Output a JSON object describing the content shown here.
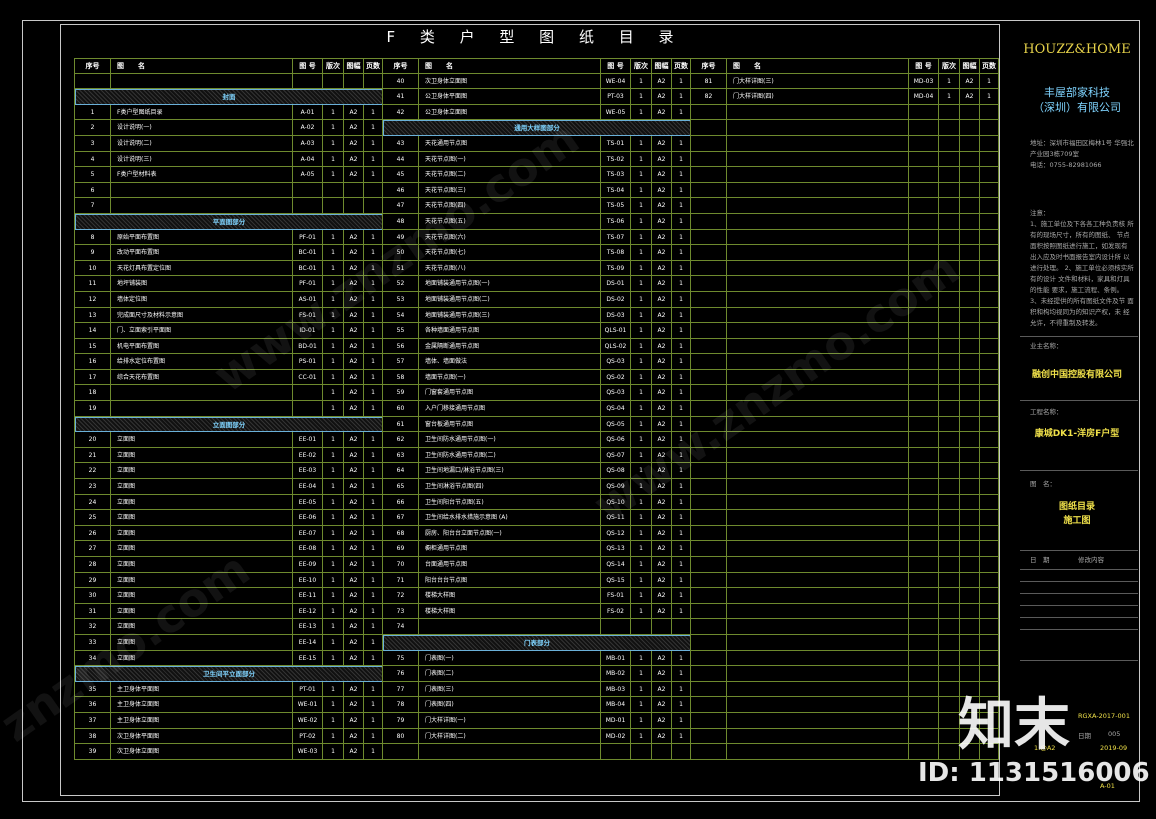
{
  "title": "F 类 户 型 图 纸 目 录",
  "headers": {
    "no": "序号",
    "name": "图　　名",
    "code": "图 号",
    "ver": "版次",
    "size": "图幅",
    "pages": "页数"
  },
  "columns": [
    [
      {
        "type": "blank"
      },
      {
        "type": "section",
        "label": "封面"
      },
      {
        "no": "1",
        "name": "F类户型图纸目录",
        "code": "A-01",
        "ver": "1",
        "size": "A2",
        "pages": "1"
      },
      {
        "no": "2",
        "name": "设计说明(一)",
        "code": "A-02",
        "ver": "1",
        "size": "A2",
        "pages": "1"
      },
      {
        "no": "3",
        "name": "设计说明(二)",
        "code": "A-03",
        "ver": "1",
        "size": "A2",
        "pages": "1"
      },
      {
        "no": "4",
        "name": "设计说明(三)",
        "code": "A-04",
        "ver": "1",
        "size": "A2",
        "pages": "1"
      },
      {
        "no": "5",
        "name": "F类户型材料表",
        "code": "A-05",
        "ver": "1",
        "size": "A2",
        "pages": "1"
      },
      {
        "no": "6",
        "name": "",
        "code": "",
        "ver": "",
        "size": "",
        "pages": ""
      },
      {
        "no": "7",
        "name": "",
        "code": "",
        "ver": "",
        "size": "",
        "pages": ""
      },
      {
        "type": "section",
        "label": "平面图部分"
      },
      {
        "no": "8",
        "name": "原始平面布置图",
        "code": "PF-01",
        "ver": "1",
        "size": "A2",
        "pages": "1"
      },
      {
        "no": "9",
        "name": "改动平面布置图",
        "code": "BC-01",
        "ver": "1",
        "size": "A2",
        "pages": "1"
      },
      {
        "no": "10",
        "name": "天花灯具布置定位图",
        "code": "BC-01",
        "ver": "1",
        "size": "A2",
        "pages": "1"
      },
      {
        "no": "11",
        "name": "地坪铺装图",
        "code": "PF-01",
        "ver": "1",
        "size": "A2",
        "pages": "1"
      },
      {
        "no": "12",
        "name": "墙体定位图",
        "code": "AS-01",
        "ver": "1",
        "size": "A2",
        "pages": "1"
      },
      {
        "no": "13",
        "name": "完成面尺寸及材料示意图",
        "code": "FS-01",
        "ver": "1",
        "size": "A2",
        "pages": "1"
      },
      {
        "no": "14",
        "name": "门、立面索引平面图",
        "code": "ID-01",
        "ver": "1",
        "size": "A2",
        "pages": "1"
      },
      {
        "no": "15",
        "name": "机电平面布置图",
        "code": "BD-01",
        "ver": "1",
        "size": "A2",
        "pages": "1"
      },
      {
        "no": "16",
        "name": "给排水定位布置图",
        "code": "PS-01",
        "ver": "1",
        "size": "A2",
        "pages": "1"
      },
      {
        "no": "17",
        "name": "综合天花布置图",
        "code": "CC-01",
        "ver": "1",
        "size": "A2",
        "pages": "1"
      },
      {
        "no": "18",
        "name": "",
        "code": "",
        "ver": "1",
        "size": "A2",
        "pages": "1"
      },
      {
        "no": "19",
        "name": "",
        "code": "",
        "ver": "1",
        "size": "A2",
        "pages": "1"
      },
      {
        "type": "section",
        "label": "立面图部分"
      },
      {
        "no": "20",
        "name": "立面图",
        "code": "EE-01",
        "ver": "1",
        "size": "A2",
        "pages": "1"
      },
      {
        "no": "21",
        "name": "立面图",
        "code": "EE-02",
        "ver": "1",
        "size": "A2",
        "pages": "1"
      },
      {
        "no": "22",
        "name": "立面图",
        "code": "EE-03",
        "ver": "1",
        "size": "A2",
        "pages": "1"
      },
      {
        "no": "23",
        "name": "立面图",
        "code": "EE-04",
        "ver": "1",
        "size": "A2",
        "pages": "1"
      },
      {
        "no": "24",
        "name": "立面图",
        "code": "EE-05",
        "ver": "1",
        "size": "A2",
        "pages": "1"
      },
      {
        "no": "25",
        "name": "立面图",
        "code": "EE-06",
        "ver": "1",
        "size": "A2",
        "pages": "1"
      },
      {
        "no": "26",
        "name": "立面图",
        "code": "EE-07",
        "ver": "1",
        "size": "A2",
        "pages": "1"
      },
      {
        "no": "27",
        "name": "立面图",
        "code": "EE-08",
        "ver": "1",
        "size": "A2",
        "pages": "1"
      },
      {
        "no": "28",
        "name": "立面图",
        "code": "EE-09",
        "ver": "1",
        "size": "A2",
        "pages": "1"
      },
      {
        "no": "29",
        "name": "立面图",
        "code": "EE-10",
        "ver": "1",
        "size": "A2",
        "pages": "1"
      },
      {
        "no": "30",
        "name": "立面图",
        "code": "EE-11",
        "ver": "1",
        "size": "A2",
        "pages": "1"
      },
      {
        "no": "31",
        "name": "立面图",
        "code": "EE-12",
        "ver": "1",
        "size": "A2",
        "pages": "1"
      },
      {
        "no": "32",
        "name": "立面图",
        "code": "EE-13",
        "ver": "1",
        "size": "A2",
        "pages": "1"
      },
      {
        "no": "33",
        "name": "立面图",
        "code": "EE-14",
        "ver": "1",
        "size": "A2",
        "pages": "1"
      },
      {
        "no": "34",
        "name": "立面图",
        "code": "EE-15",
        "ver": "1",
        "size": "A2",
        "pages": "1"
      },
      {
        "type": "section",
        "label": "卫生间平立面部分"
      },
      {
        "no": "35",
        "name": "主卫身体平面图",
        "code": "PT-01",
        "ver": "1",
        "size": "A2",
        "pages": "1"
      },
      {
        "no": "36",
        "name": "主卫身体立面图",
        "code": "WE-01",
        "ver": "1",
        "size": "A2",
        "pages": "1"
      },
      {
        "no": "37",
        "name": "主卫身体立面图",
        "code": "WE-02",
        "ver": "1",
        "size": "A2",
        "pages": "1"
      },
      {
        "no": "38",
        "name": "次卫身体平面图",
        "code": "PT-02",
        "ver": "1",
        "size": "A2",
        "pages": "1"
      },
      {
        "no": "39",
        "name": "次卫身体立面图",
        "code": "WE-03",
        "ver": "1",
        "size": "A2",
        "pages": "1"
      }
    ],
    [
      {
        "no": "40",
        "name": "次卫身体立面图",
        "code": "WE-04",
        "ver": "1",
        "size": "A2",
        "pages": "1"
      },
      {
        "no": "41",
        "name": "公卫身体平面图",
        "code": "PT-03",
        "ver": "1",
        "size": "A2",
        "pages": "1"
      },
      {
        "no": "42",
        "name": "公卫身体立面图",
        "code": "WE-05",
        "ver": "1",
        "size": "A2",
        "pages": "1"
      },
      {
        "type": "section",
        "label": "通用大样图部分"
      },
      {
        "no": "43",
        "name": "天花通用节点图",
        "code": "TS-01",
        "ver": "1",
        "size": "A2",
        "pages": "1"
      },
      {
        "no": "44",
        "name": "天花节点图(一)",
        "code": "TS-02",
        "ver": "1",
        "size": "A2",
        "pages": "1"
      },
      {
        "no": "45",
        "name": "天花节点图(二)",
        "code": "TS-03",
        "ver": "1",
        "size": "A2",
        "pages": "1"
      },
      {
        "no": "46",
        "name": "天花节点图(三)",
        "code": "TS-04",
        "ver": "1",
        "size": "A2",
        "pages": "1"
      },
      {
        "no": "47",
        "name": "天花节点图(四)",
        "code": "TS-05",
        "ver": "1",
        "size": "A2",
        "pages": "1"
      },
      {
        "no": "48",
        "name": "天花节点图(五)",
        "code": "TS-06",
        "ver": "1",
        "size": "A2",
        "pages": "1"
      },
      {
        "no": "49",
        "name": "天花节点图(六)",
        "code": "TS-07",
        "ver": "1",
        "size": "A2",
        "pages": "1"
      },
      {
        "no": "50",
        "name": "天花节点图(七)",
        "code": "TS-08",
        "ver": "1",
        "size": "A2",
        "pages": "1"
      },
      {
        "no": "51",
        "name": "天花节点图(八)",
        "code": "TS-09",
        "ver": "1",
        "size": "A2",
        "pages": "1"
      },
      {
        "no": "52",
        "name": "地面铺装通用节点图(一)",
        "code": "DS-01",
        "ver": "1",
        "size": "A2",
        "pages": "1"
      },
      {
        "no": "53",
        "name": "地面铺装通用节点图(二)",
        "code": "DS-02",
        "ver": "1",
        "size": "A2",
        "pages": "1"
      },
      {
        "no": "54",
        "name": "地面铺装通用节点图(三)",
        "code": "DS-03",
        "ver": "1",
        "size": "A2",
        "pages": "1"
      },
      {
        "no": "55",
        "name": "各种墙面通用节点图",
        "code": "QLS-01",
        "ver": "1",
        "size": "A2",
        "pages": "1"
      },
      {
        "no": "56",
        "name": "金属隔断通用节点图",
        "code": "QLS-02",
        "ver": "1",
        "size": "A2",
        "pages": "1"
      },
      {
        "no": "57",
        "name": "墙体、墙面做法",
        "code": "QS-03",
        "ver": "1",
        "size": "A2",
        "pages": "1"
      },
      {
        "no": "58",
        "name": "墙面节点图(一)",
        "code": "QS-02",
        "ver": "1",
        "size": "A2",
        "pages": "1"
      },
      {
        "no": "59",
        "name": "门窗套通用节点图",
        "code": "QS-03",
        "ver": "1",
        "size": "A2",
        "pages": "1"
      },
      {
        "no": "60",
        "name": "入户门移接通用节点图",
        "code": "QS-04",
        "ver": "1",
        "size": "A2",
        "pages": "1"
      },
      {
        "no": "61",
        "name": "窗台板通用节点图",
        "code": "QS-05",
        "ver": "1",
        "size": "A2",
        "pages": "1"
      },
      {
        "no": "62",
        "name": "卫生间防水通用节点图(一)",
        "code": "QS-06",
        "ver": "1",
        "size": "A2",
        "pages": "1"
      },
      {
        "no": "63",
        "name": "卫生间防水通用节点图(二)",
        "code": "QS-07",
        "ver": "1",
        "size": "A2",
        "pages": "1"
      },
      {
        "no": "64",
        "name": "卫生间地漏口/淋浴节点图(三)",
        "code": "QS-08",
        "ver": "1",
        "size": "A2",
        "pages": "1"
      },
      {
        "no": "65",
        "name": "卫生间淋浴节点图(四)",
        "code": "QS-09",
        "ver": "1",
        "size": "A2",
        "pages": "1"
      },
      {
        "no": "66",
        "name": "卫生间阳台节点图(五)",
        "code": "QS-10",
        "ver": "1",
        "size": "A2",
        "pages": "1"
      },
      {
        "no": "67",
        "name": "卫生间给水排水措施示意图 (A)",
        "code": "QS-11",
        "ver": "1",
        "size": "A2",
        "pages": "1"
      },
      {
        "no": "68",
        "name": "厨房、阳台台立面节点图(一)",
        "code": "QS-12",
        "ver": "1",
        "size": "A2",
        "pages": "1"
      },
      {
        "no": "69",
        "name": "橱柜通用节点图",
        "code": "QS-13",
        "ver": "1",
        "size": "A2",
        "pages": "1"
      },
      {
        "no": "70",
        "name": "台面通用节点图",
        "code": "QS-14",
        "ver": "1",
        "size": "A2",
        "pages": "1"
      },
      {
        "no": "71",
        "name": "阳台台台节点图",
        "code": "QS-15",
        "ver": "1",
        "size": "A2",
        "pages": "1"
      },
      {
        "no": "72",
        "name": "楼梯大样图",
        "code": "FS-01",
        "ver": "1",
        "size": "A2",
        "pages": "1"
      },
      {
        "no": "73",
        "name": "楼梯大样图",
        "code": "FS-02",
        "ver": "1",
        "size": "A2",
        "pages": "1"
      },
      {
        "no": "74",
        "name": "",
        "code": "",
        "ver": "",
        "size": "",
        "pages": ""
      },
      {
        "type": "section",
        "label": "门表部分"
      },
      {
        "no": "75",
        "name": "门表图(一)",
        "code": "MB-01",
        "ver": "1",
        "size": "A2",
        "pages": "1"
      },
      {
        "no": "76",
        "name": "门表图(二)",
        "code": "MB-02",
        "ver": "1",
        "size": "A2",
        "pages": "1"
      },
      {
        "no": "77",
        "name": "门表图(三)",
        "code": "MB-03",
        "ver": "1",
        "size": "A2",
        "pages": "1"
      },
      {
        "no": "78",
        "name": "门表图(四)",
        "code": "MB-04",
        "ver": "1",
        "size": "A2",
        "pages": "1"
      },
      {
        "no": "79",
        "name": "门大样详图(一)",
        "code": "MD-01",
        "ver": "1",
        "size": "A2",
        "pages": "1"
      },
      {
        "no": "80",
        "name": "门大样详图(二)",
        "code": "MD-02",
        "ver": "1",
        "size": "A2",
        "pages": "1"
      }
    ],
    [
      {
        "no": "81",
        "name": "门大样详图(三)",
        "code": "MD-03",
        "ver": "1",
        "size": "A2",
        "pages": "1"
      },
      {
        "no": "82",
        "name": "门大样详图(四)",
        "code": "MD-04",
        "ver": "1",
        "size": "A2",
        "pages": "1"
      }
    ]
  ],
  "panel": {
    "brand": "HOUZZ&HOME",
    "company_line1": "丰屋部家科技",
    "company_line2": "（深圳）有限公司",
    "address": "地址：深圳市福田区梅林1号 华强北产业园3栋709室",
    "phone": "电话：0755-82981066",
    "notes_label": "注意：",
    "notes": "1、施工单位及下各各工种负责核 所有的现场尺寸，所有的图纸、 节点面积按照图纸进行施工，如发现有 出入应及时书面报告室内设计所 以进行处理。 2、施工单位必须核实所有的设计 文件和材料，家具和灯具的性能 要求，施工流程、条例。 3、未经提供的所有图纸文件及节 面积和构均视同为的知识产权，未 经允许，不得重制及转发。",
    "owner_label": "业主名称：",
    "owner": "融创中国控股有限公司",
    "project_label": "工程名称：",
    "project": "康城DK1-洋房F户型",
    "drawing_label": "图　名：",
    "drawing_line1": "图纸目录",
    "drawing_line2": "施工图",
    "rev_label1": "日　期",
    "rev_label2": "修改内容",
    "drawing_no": "RGXA-2017-001",
    "date_label": "日期",
    "date_code": "005",
    "scale": "1:@A2",
    "date": "2019-09",
    "sheet": "A-01"
  },
  "watermarks": {
    "logo": "知末",
    "id": "ID: 1131516006",
    "faint": "www.znzmo.com",
    "side": "znzmo.com"
  }
}
